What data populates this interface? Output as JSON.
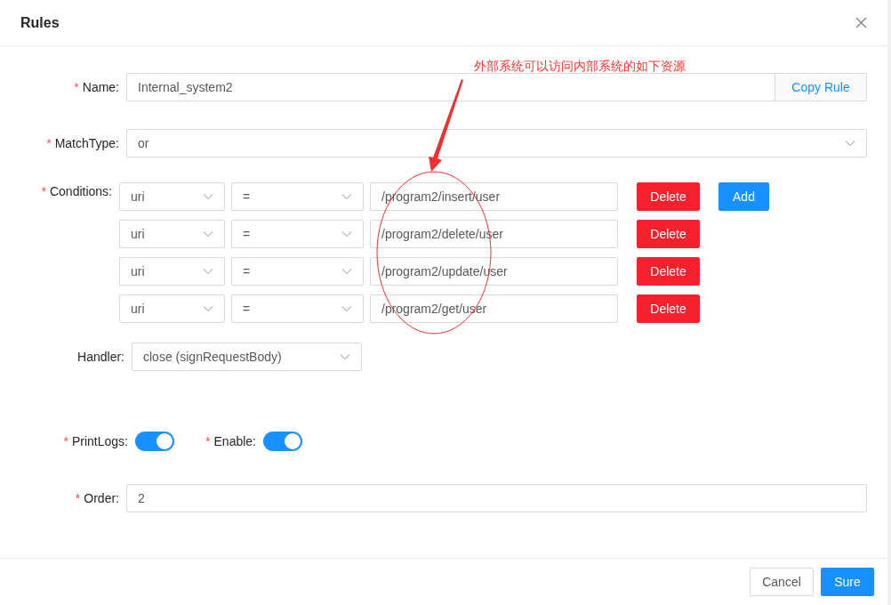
{
  "dialog": {
    "title": "Rules"
  },
  "name": {
    "mark": "*",
    "label": "Name:",
    "value": "Internal_system2",
    "addon": "Copy Rule"
  },
  "match_type": {
    "mark": "*",
    "label": "MatchType:",
    "value": "or"
  },
  "conditions": {
    "mark": "*",
    "label": "Conditions:",
    "add_button": "Add",
    "rows": [
      {
        "field": "uri",
        "operator": "=",
        "value": "/program2/insert/user",
        "delete_button": "Delete"
      },
      {
        "field": "uri",
        "operator": "=",
        "value": "/program2/delete/user",
        "delete_button": "Delete"
      },
      {
        "field": "uri",
        "operator": "=",
        "value": "/program2/update/user",
        "delete_button": "Delete"
      },
      {
        "field": "uri",
        "operator": "=",
        "value": "/program2/get/user",
        "delete_button": "Delete"
      }
    ]
  },
  "handler": {
    "label": "Handler:",
    "value": "close (signRequestBody)"
  },
  "switches": [
    {
      "mark": "*",
      "label": "PrintLogs:",
      "on": true
    },
    {
      "mark": "*",
      "label": "Enable:",
      "on": true
    }
  ],
  "order": {
    "mark": "*",
    "label": "Order:",
    "value": "2"
  },
  "annotation": {
    "text": "外部系统可以访问内部系统的如下资源"
  },
  "footer": {
    "cancel": "Cancel",
    "confirm": "Sure"
  }
}
